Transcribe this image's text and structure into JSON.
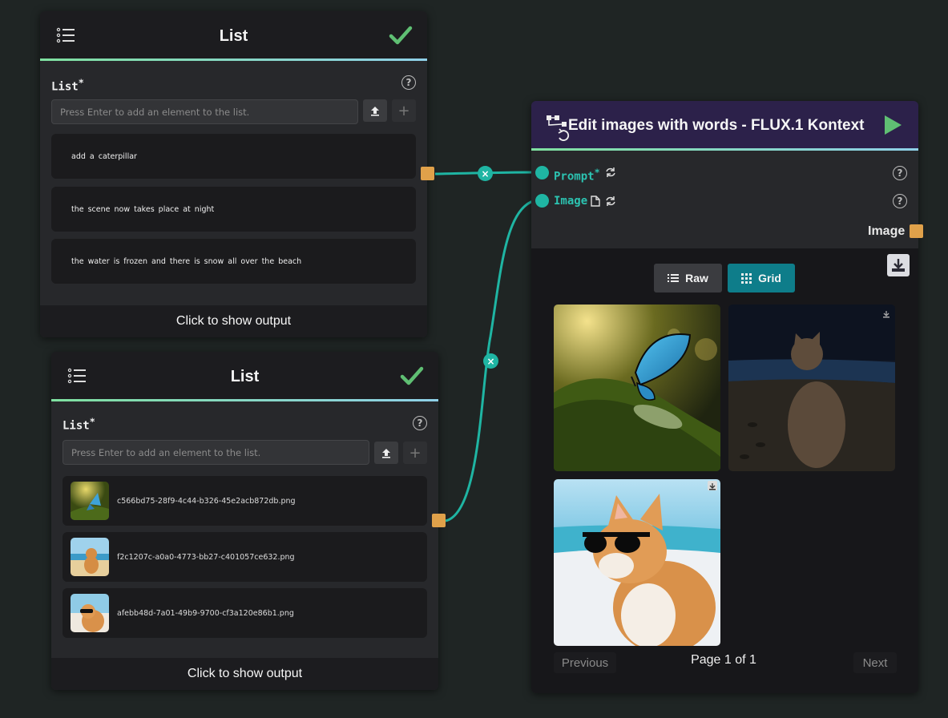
{
  "list_node_1": {
    "title": "List",
    "field_label": "List",
    "required_mark": "*",
    "placeholder": "Press Enter to add an element to the list.",
    "items": [
      "add a caterpillar",
      "the scene now takes place at night",
      "the water is frozen and there is snow all over the beach"
    ],
    "output_label": "Click to show output"
  },
  "list_node_2": {
    "title": "List",
    "field_label": "List",
    "required_mark": "*",
    "placeholder": "Press Enter to add an element to the list.",
    "files": [
      "c566bd75-28f9-4c44-b326-45e2acb872db.png",
      "f2c1207c-a0a0-4773-bb27-c401057ce632.png",
      "afebb48d-7a01-49b9-9700-cf3a120e86b1.png"
    ],
    "output_label": "Click to show output"
  },
  "flux_node": {
    "title": "Edit images with words - FLUX.1 Kontext",
    "inputs": [
      {
        "label": "Prompt",
        "required": "*"
      },
      {
        "label": "Image"
      }
    ],
    "output_label": "Image",
    "view_raw": "Raw",
    "view_grid": "Grid",
    "pagination": {
      "prev": "Previous",
      "page_text": "Page 1 of 1",
      "next": "Next"
    }
  },
  "colors": {
    "wire": "#1fb5a3",
    "port": "#e0a14a",
    "accent_teal": "#0e7d8a",
    "check_green": "#5fbf73"
  }
}
